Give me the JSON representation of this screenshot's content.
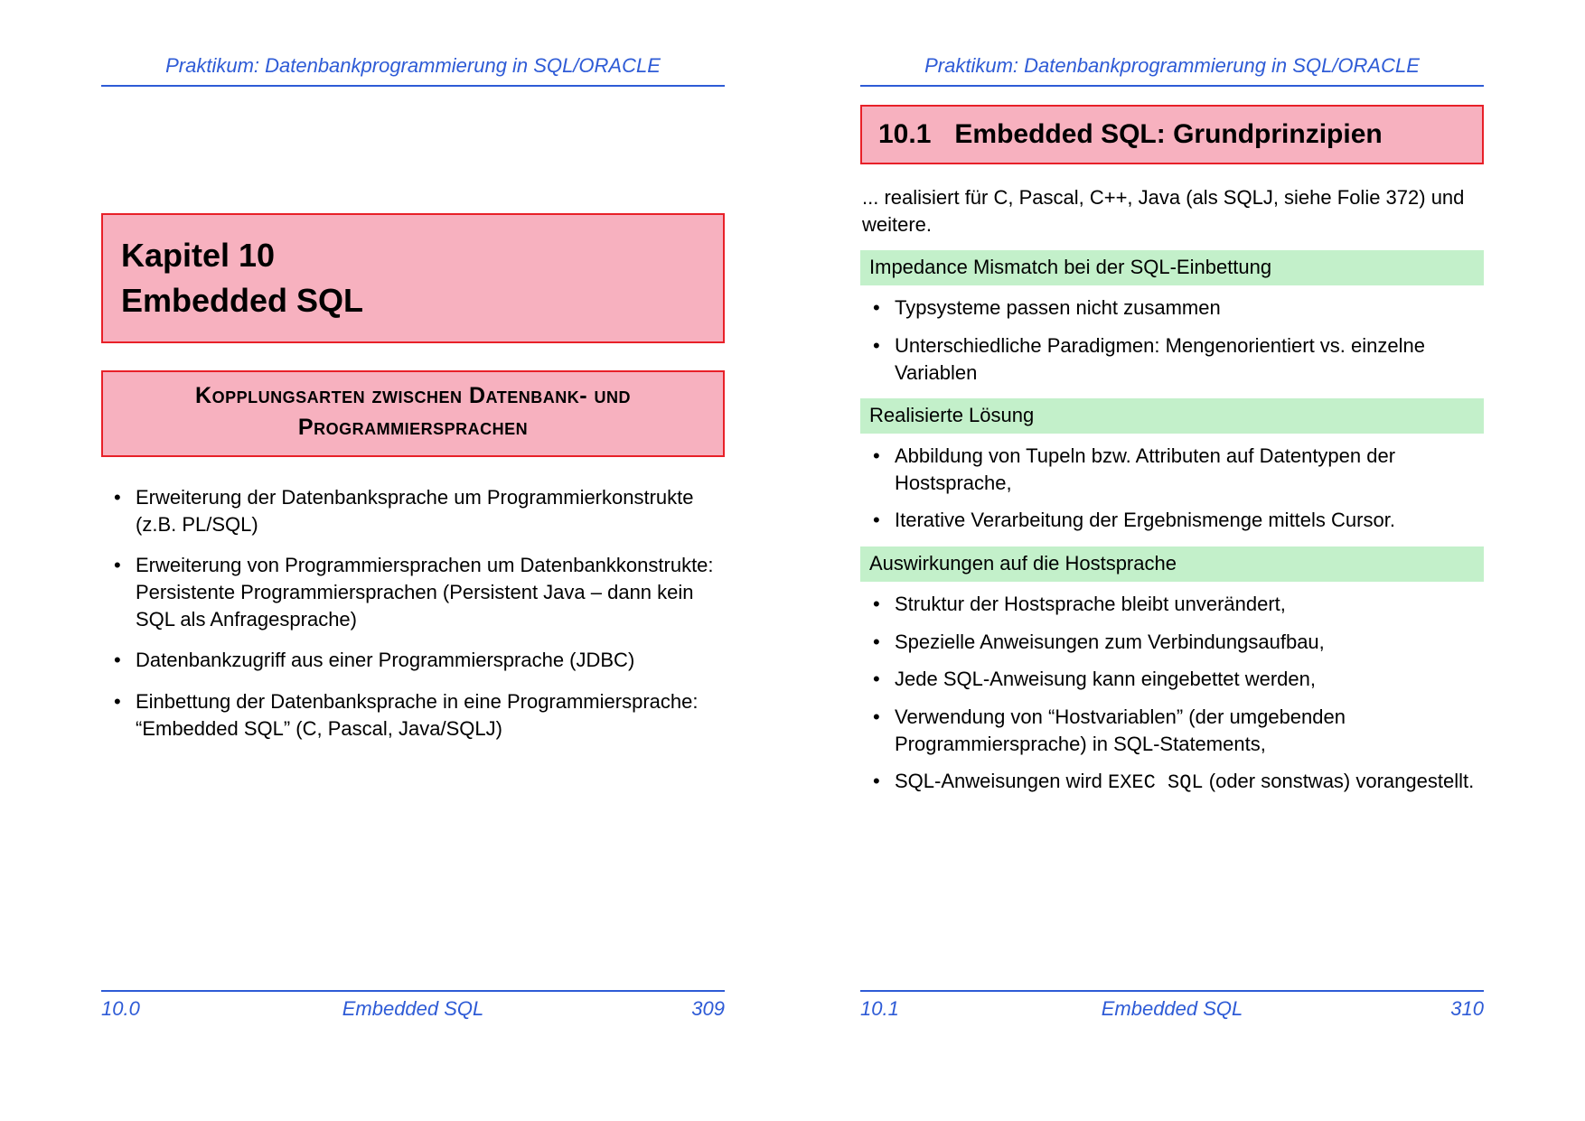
{
  "header": "Praktikum: Datenbankprogrammierung in SQL/ORACLE",
  "left": {
    "chapter_line1": "Kapitel 10",
    "chapter_line2": "Embedded SQL",
    "subheading_line1": "Kopplungsarten zwischen Datenbank- und",
    "subheading_line2": "Programmiersprachen",
    "bullets": [
      "Erweiterung der Datenbanksprache um Programmierkonstrukte (z.B. PL/SQL)",
      "Erweiterung von Programmiersprachen um Datenbankkonstrukte: Persistente Programmiersprachen (Persistent Java – dann kein SQL als Anfragesprache)",
      "Datenbankzugriff aus einer Programmiersprache (JDBC)",
      "Einbettung der Datenbanksprache in eine Programmiersprache: “Embedded SQL” (C, Pascal, Java/SQLJ)"
    ],
    "footer": {
      "section": "10.0",
      "title": "Embedded SQL",
      "page": "309"
    }
  },
  "right": {
    "section_num": "10.1",
    "section_title": "Embedded SQL: Grundprinzipien",
    "intro": "... realisiert für C, Pascal, C++, Java (als SQLJ, siehe Folie 372) und weitere.",
    "bar1": "Impedance Mismatch bei der SQL-Einbettung",
    "bullets1": [
      "Typsysteme passen nicht zusammen",
      "Unterschiedliche Paradigmen: Mengenorientiert vs. einzelne Variablen"
    ],
    "bar2": "Realisierte Lösung",
    "bullets2": [
      "Abbildung von Tupeln bzw. Attributen auf Datentypen der Hostsprache,",
      "Iterative Verarbeitung der Ergebnismenge mittels Cursor."
    ],
    "bar3": "Auswirkungen auf die Hostsprache",
    "bullets3_pre": [
      "Struktur der Hostsprache bleibt unverändert,",
      "Spezielle Anweisungen zum Verbindungsaufbau,",
      "Jede SQL-Anweisung kann eingebettet werden,",
      "Verwendung von “Hostvariablen” (der umgebenden Programmiersprache) in SQL-Statements,"
    ],
    "bullets3_last_before": "SQL-Anweisungen wird ",
    "bullets3_last_code": "EXEC SQL",
    "bullets3_last_after": " (oder sonstwas) vorangestellt.",
    "footer": {
      "section": "10.1",
      "title": "Embedded SQL",
      "page": "310"
    }
  }
}
